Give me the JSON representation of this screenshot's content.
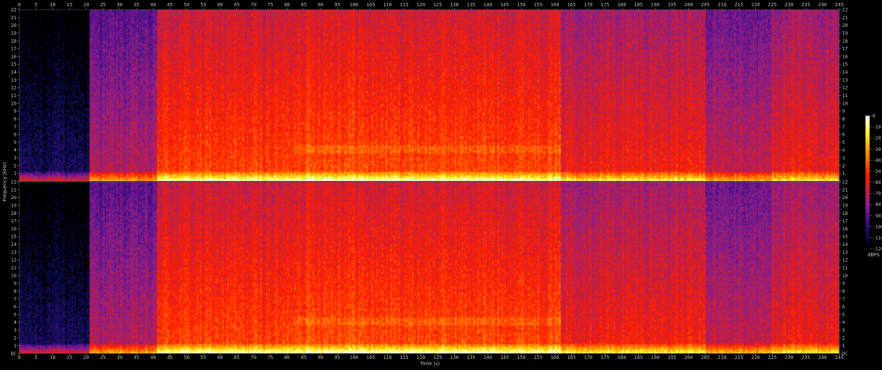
{
  "chart_data": {
    "type": "heatmap",
    "title": "",
    "xlabel": "Time (s)",
    "ylabel": "Frequency (kHz)",
    "xlim": [
      0,
      245
    ],
    "ylim": [
      0,
      22
    ],
    "x_ticks": [
      "0",
      "5",
      "10",
      "15",
      "20",
      "25",
      "30",
      "35",
      "40",
      "45",
      "50",
      "55",
      "60",
      "65",
      "70",
      "75",
      "80",
      "85",
      "90",
      "95",
      "100",
      "105",
      "110",
      "115",
      "120",
      "125",
      "130",
      "135",
      "140",
      "145",
      "150",
      "155",
      "160",
      "165",
      "170",
      "175",
      "180",
      "185",
      "190",
      "195",
      "200",
      "205",
      "210",
      "215",
      "220",
      "225",
      "230",
      "235",
      "240",
      "245"
    ],
    "y_ticks": [
      "DC",
      "1",
      "2",
      "3",
      "4",
      "5",
      "6",
      "7",
      "8",
      "9",
      "10",
      "11",
      "12",
      "13",
      "14",
      "15",
      "16",
      "17",
      "18",
      "19",
      "20",
      "21",
      "22"
    ],
    "channels": 2,
    "colorbar": {
      "label": "dBFS",
      "range": [
        -120,
        0
      ],
      "ticks": [
        "0",
        "-10",
        "-20",
        "-30",
        "-40",
        "-50",
        "-60",
        "-70",
        "-80",
        "-90",
        "-100",
        "-110",
        "-120"
      ]
    },
    "sections": [
      {
        "start": 0,
        "end": 21,
        "level": -105
      },
      {
        "start": 21,
        "end": 41,
        "level": -72
      },
      {
        "start": 41,
        "end": 82,
        "level": -48
      },
      {
        "start": 82,
        "end": 102,
        "level": -44
      },
      {
        "start": 102,
        "end": 162,
        "level": -46
      },
      {
        "start": 162,
        "end": 205,
        "level": -56
      },
      {
        "start": 205,
        "end": 225,
        "level": -68
      },
      {
        "start": 225,
        "end": 245,
        "level": -58
      }
    ],
    "colormap": [
      "#000000",
      "#0c0c50",
      "#4a0f8a",
      "#8a1f8a",
      "#c81f3c",
      "#ff2000",
      "#ff6a00",
      "#ffb000",
      "#ffff40",
      "#ffffff"
    ]
  }
}
